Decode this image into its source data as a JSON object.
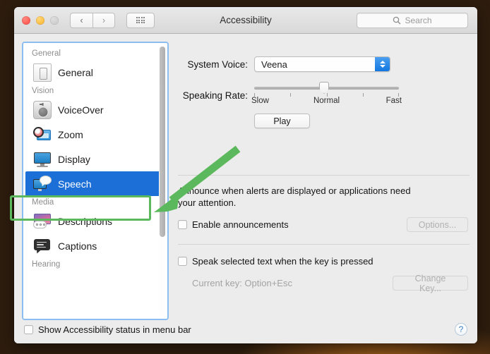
{
  "window": {
    "title": "Accessibility",
    "traffic_lights": [
      "close-red",
      "minimize-yellow",
      "zoom-disabled-gray"
    ],
    "nav": {
      "back": "‹",
      "forward": "›"
    },
    "grid_button": "show-all-icon",
    "search": {
      "placeholder": "Search",
      "icon": "search-icon",
      "value": ""
    }
  },
  "sidebar": {
    "groups": [
      {
        "title": "General",
        "items": [
          {
            "label": "General",
            "icon": "general-icon",
            "selected": false
          }
        ]
      },
      {
        "title": "Vision",
        "items": [
          {
            "label": "VoiceOver",
            "icon": "voiceover-icon",
            "selected": false
          },
          {
            "label": "Zoom",
            "icon": "zoom-icon",
            "selected": false
          },
          {
            "label": "Display",
            "icon": "display-icon",
            "selected": false
          },
          {
            "label": "Speech",
            "icon": "speech-icon",
            "selected": true
          }
        ]
      },
      {
        "title": "Media",
        "items": [
          {
            "label": "Descriptions",
            "icon": "descriptions-icon",
            "selected": false
          },
          {
            "label": "Captions",
            "icon": "captions-icon",
            "selected": false
          }
        ]
      },
      {
        "title": "Hearing",
        "items": []
      }
    ],
    "selected_item": "Speech",
    "scrollbar": "vertical-scrollbar"
  },
  "main": {
    "system_voice": {
      "label": "System Voice:",
      "value": "Veena"
    },
    "speaking_rate": {
      "label": "Speaking Rate:",
      "tick_labels": [
        "Slow",
        "Normal",
        "Fast"
      ],
      "position_label": "Normal",
      "value_percent": 50,
      "tick_count": 5
    },
    "play_button": "Play",
    "announce": {
      "description": "Announce when alerts are displayed or applications need your attention.",
      "checkbox_label": "Enable announcements",
      "checked": false,
      "options_button": "Options...",
      "options_disabled": true
    },
    "speak_selected": {
      "checkbox_label": "Speak selected text when the key is pressed",
      "checked": false,
      "current_key_label": "Current key: Option+Esc",
      "change_key_button": "Change Key...",
      "change_key_disabled": true
    }
  },
  "bottom": {
    "checkbox_label": "Show Accessibility status in menu bar",
    "checked": false,
    "help_button": "?"
  },
  "annotation": {
    "arrow_color": "#5cb85c",
    "highlight_color": "#5cb85c",
    "target": "Speech"
  },
  "colors": {
    "selection_blue": "#1c6fd6",
    "focus_ring": "#8bbdf0",
    "window_bg": "#ececec",
    "stepper_blue": "#1277e0"
  }
}
